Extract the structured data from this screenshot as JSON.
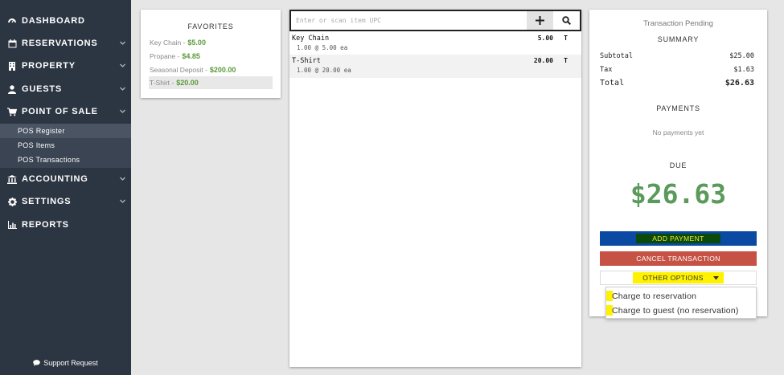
{
  "sidebar": {
    "items": [
      {
        "label": "DASHBOARD",
        "icon": "dashboard-icon"
      },
      {
        "label": "RESERVATIONS",
        "icon": "calendar-icon"
      },
      {
        "label": "PROPERTY",
        "icon": "building-icon"
      },
      {
        "label": "GUESTS",
        "icon": "user-icon"
      },
      {
        "label": "POINT OF SALE",
        "icon": "cart-icon"
      },
      {
        "label": "ACCOUNTING",
        "icon": "bank-icon"
      },
      {
        "label": "SETTINGS",
        "icon": "gear-icon"
      },
      {
        "label": "REPORTS",
        "icon": "chart-icon"
      }
    ],
    "sub_items": [
      "POS Register",
      "POS Items",
      "POS Transactions"
    ],
    "support": "Support Request"
  },
  "favorites": {
    "title": "FAVORITES",
    "items": [
      {
        "name": "Key Chain",
        "price": "$5.00"
      },
      {
        "name": "Propane",
        "price": "$4.85"
      },
      {
        "name": "Seasonal Deposit",
        "price": "$200.00"
      },
      {
        "name": "T-Shirt",
        "price": "$20.00"
      }
    ]
  },
  "scan": {
    "placeholder": "Enter or scan item UPC"
  },
  "cart": {
    "lines": [
      {
        "name": "Key Chain",
        "detail": "1.00 @ 5.00 ea",
        "amount": "5.00",
        "tax": "T"
      },
      {
        "name": "T-Shirt",
        "detail": "1.00 @ 20.00 ea",
        "amount": "20.00",
        "tax": "T"
      }
    ]
  },
  "summary": {
    "status": "Transaction Pending",
    "title": "SUMMARY",
    "subtotal_label": "Subtotal",
    "subtotal": "$25.00",
    "tax_label": "Tax",
    "tax": "$1.63",
    "total_label": "Total",
    "total": "$26.63",
    "payments_title": "PAYMENTS",
    "no_payments": "No payments yet",
    "due_title": "DUE",
    "due_amount": "$26.63",
    "add_payment": "ADD PAYMENT",
    "cancel": "CANCEL TRANSACTION",
    "other_options": "OTHER OPTIONS"
  },
  "dropdown": {
    "items": [
      "Charge to reservation",
      "Charge to guest (no reservation)"
    ]
  },
  "colors": {
    "sidebar_bg": "#2c3542",
    "price_green": "#5a9a3a",
    "due_green": "#5a9a5a",
    "add_payment_bg": "#0b4aa2",
    "cancel_bg": "#c65245",
    "highlight": "#fff200"
  }
}
